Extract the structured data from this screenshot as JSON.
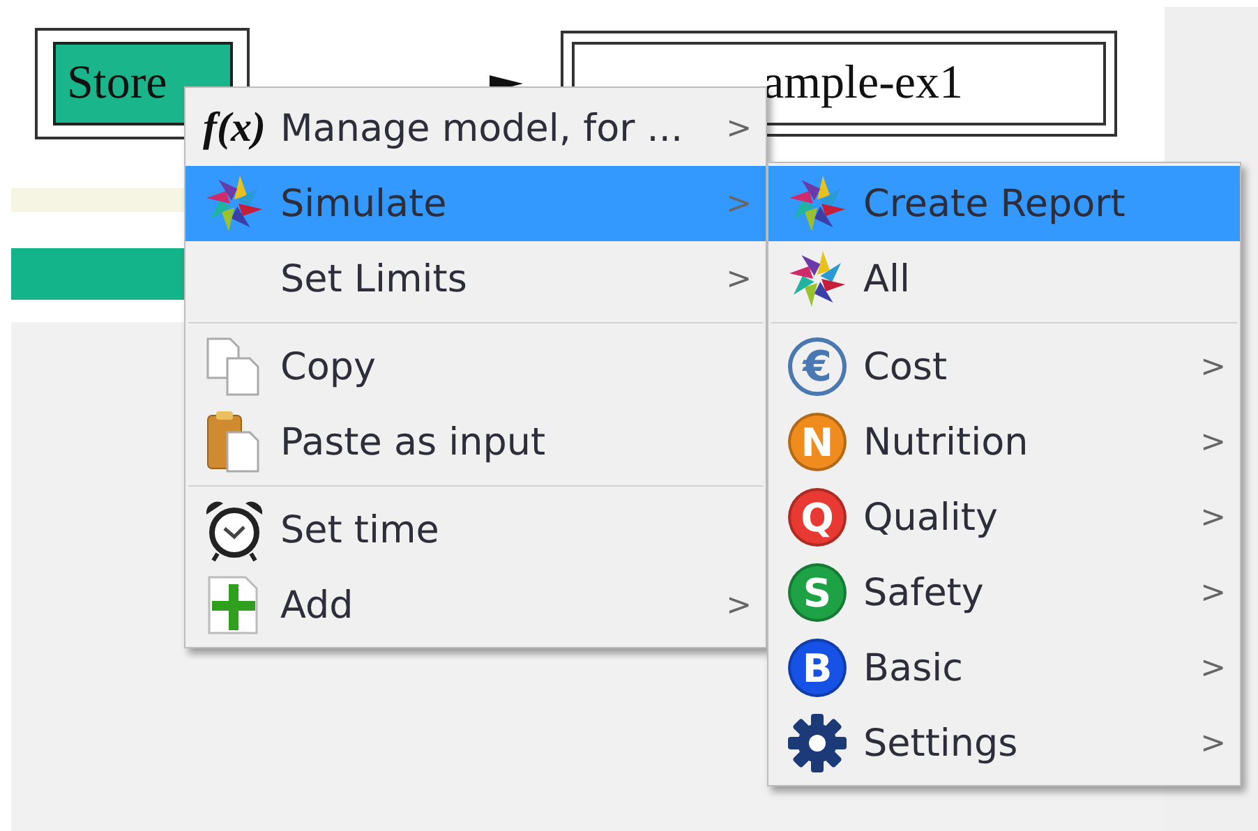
{
  "store_button": {
    "label": "Store"
  },
  "model_field": {
    "value": "ample-ex1"
  },
  "context_menu": {
    "groups": [
      [
        {
          "kind": "formula",
          "icon_text": "f(x)",
          "label": "Manage model, for ...",
          "arrow": ">",
          "selected": false
        },
        {
          "kind": "star",
          "label": "Simulate",
          "arrow": ">",
          "selected": true
        },
        {
          "kind": "plain",
          "label": "Set Limits",
          "arrow": ">",
          "selected": false
        }
      ],
      [
        {
          "kind": "copy",
          "label": "Copy",
          "selected": false
        },
        {
          "kind": "paste",
          "label": "Paste as input",
          "selected": false
        }
      ],
      [
        {
          "kind": "clock",
          "label": "Set time",
          "selected": false
        },
        {
          "kind": "add",
          "label": "Add",
          "arrow": ">",
          "selected": false
        }
      ]
    ]
  },
  "submenu": {
    "groups": [
      [
        {
          "kind": "star",
          "label": "Create Report",
          "selected": true
        },
        {
          "kind": "star",
          "label": "All",
          "selected": false
        }
      ],
      [
        {
          "kind": "outline-badge",
          "icon_text": "€",
          "color": "#4a78b0",
          "label": "Cost",
          "arrow": ">",
          "selected": false
        },
        {
          "kind": "badge",
          "icon_text": "N",
          "color": "#f08c1e",
          "label": "Nutrition",
          "arrow": ">",
          "selected": false
        },
        {
          "kind": "badge",
          "icon_text": "Q",
          "color": "#e83a32",
          "label": "Quality",
          "arrow": ">",
          "selected": false
        },
        {
          "kind": "badge",
          "icon_text": "S",
          "color": "#1ea246",
          "label": "Safety",
          "arrow": ">",
          "selected": false
        },
        {
          "kind": "badge",
          "icon_text": "B",
          "color": "#1652e6",
          "label": "Basic",
          "arrow": ">",
          "selected": false
        },
        {
          "kind": "gear",
          "label": "Settings",
          "arrow": ">",
          "selected": false
        }
      ]
    ]
  }
}
